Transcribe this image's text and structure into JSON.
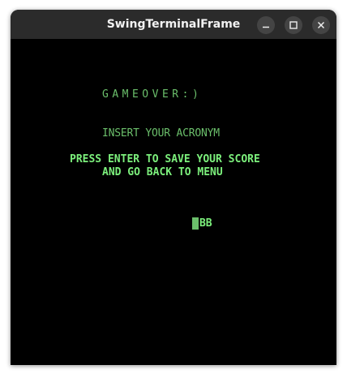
{
  "window": {
    "title": "SwingTerminalFrame",
    "controls": {
      "minimize": "minimize-icon",
      "maximize": "maximize-icon",
      "close": "close-icon"
    }
  },
  "terminal": {
    "game_over": "GAMEOVER:)",
    "instruction": "INSERT YOUR ACRONYM",
    "press_line1": "PRESS ENTER TO SAVE YOUR SCORE",
    "press_line2": "AND GO BACK TO MENU",
    "acronym_value": "BB",
    "colors": {
      "background": "#000000",
      "text_dim": "#6bbf6b",
      "text_bright": "#7cf07c"
    }
  }
}
